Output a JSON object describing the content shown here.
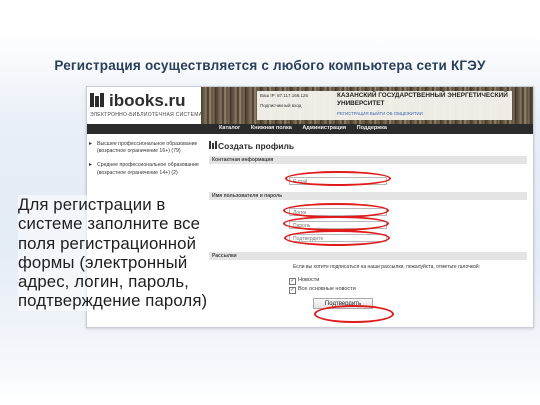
{
  "slide": {
    "title": "Регистрация осуществляется с любого компьютера сети КГЭУ",
    "instruction_lines": [
      "Для регистрации в",
      "системе заполните все",
      "поля регистрационной",
      "формы (электронный",
      "адрес, логин, пароль,",
      "подтверждение пароля)"
    ]
  },
  "site": {
    "logo": "ibooks.ru",
    "logo_subtitle": "ЭЛЕКТРОННО-БИБЛИОТЕЧНАЯ СИСТЕМА",
    "ip_line": "Ваш IP: 87.117.168.126",
    "access_line": "Подписчикный вход",
    "org_name": "КАЗАНСКИЙ ГОСУДАРСТВЕННЫЙ ЭНЕРГЕТИЧЕСКИЙ УНИВЕРСИТЕТ",
    "org_links": "РЕГИСТРАЦИЯ  ВЫЙТИ  ОБ ОБЩЕЖИТИИ"
  },
  "nav": {
    "items": [
      "Каталог",
      "Книжная полка",
      "Администрация",
      "Поддержка"
    ]
  },
  "sidebar": {
    "items": [
      "Высшее профессиональное образование (возрастное ограничение 16+) (79)",
      "Среднее профессиональное образование (возрастное ограничение 14+) (2)"
    ]
  },
  "form": {
    "title": "Создать профиль",
    "sections": {
      "contact": "Контактная информация",
      "credentials": "Имя пользователя и пароль",
      "mailing": "Рассылки"
    },
    "fields": {
      "email_placeholder": "E-mail",
      "login_placeholder": "Логин",
      "password_placeholder": "Пароль",
      "confirm_placeholder": "Подтвердите"
    },
    "newsletter_text": "Если вы хотите подписаться на наши рассылки, пожалуйста, отметьте галочкой:",
    "checkbox_news": "Новости",
    "checkbox_all": "Все основные новости",
    "submit_label": "Подтвердить"
  },
  "colors": {
    "highlight_red": "#e11a1a",
    "title_color": "#2a3f5a",
    "nav_bg": "#2b2b2b"
  }
}
